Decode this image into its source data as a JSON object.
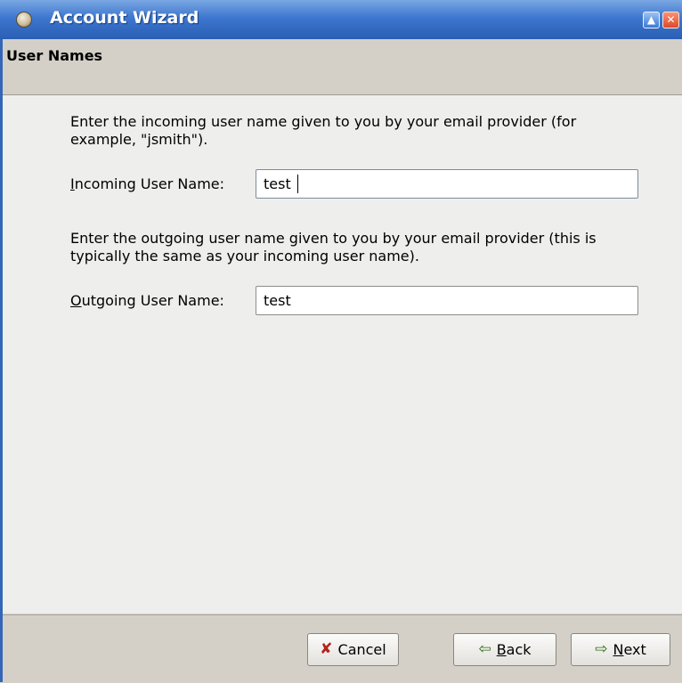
{
  "window": {
    "title": "Account Wizard",
    "maximize_symbol": "▲",
    "close_symbol": "✕"
  },
  "page": {
    "heading": "User Names"
  },
  "incoming": {
    "description": "Enter the incoming user name given to you by your email provider (for example, \"jsmith\").",
    "label_mnemonic": "I",
    "label_rest": "ncoming User Name:",
    "value": "test"
  },
  "outgoing": {
    "description": "Enter the outgoing user name given to you by your email provider (this is typically the same as your incoming user name).",
    "label_mnemonic": "O",
    "label_rest": "utgoing User Name:",
    "value": "test"
  },
  "buttons": {
    "cancel_label": "Cancel",
    "back_mnemonic": "B",
    "back_rest": "ack",
    "next_mnemonic": "N",
    "next_rest": "ext"
  },
  "icons": {
    "app": "thunderbird-app-icon",
    "cancel": "cancel-x-icon",
    "back": "back-arrow-icon",
    "next": "next-arrow-icon"
  },
  "colors": {
    "titlebar": "#3d77cf",
    "content_bg": "#eeeeec",
    "dialog_bg": "#d4d0c8"
  }
}
